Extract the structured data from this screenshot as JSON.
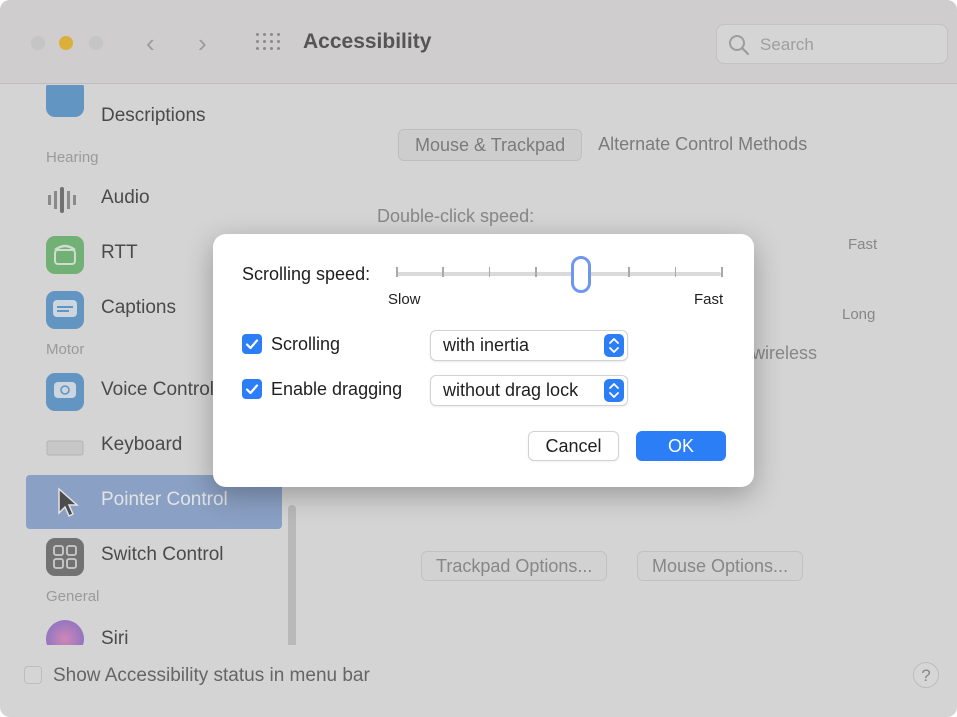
{
  "window": {
    "title": "Accessibility",
    "search_placeholder": "Search"
  },
  "sidebar": {
    "items": [
      {
        "label": "Descriptions",
        "icon": "descriptions-icon"
      },
      {
        "label": "Audio",
        "icon": "speaker-icon"
      },
      {
        "label": "RTT",
        "icon": "rtt-phone-icon"
      },
      {
        "label": "Captions",
        "icon": "captions-icon"
      },
      {
        "label": "Voice Control",
        "icon": "voice-control-icon"
      },
      {
        "label": "Keyboard",
        "icon": "keyboard-icon"
      },
      {
        "label": "Pointer Control",
        "icon": "pointer-icon",
        "selected": true
      },
      {
        "label": "Switch Control",
        "icon": "switch-control-icon"
      },
      {
        "label": "Siri",
        "icon": "siri-icon"
      }
    ],
    "headers": {
      "hearing": "Hearing",
      "motor": "Motor",
      "general": "General"
    }
  },
  "content": {
    "tabs": [
      "Mouse & Trackpad",
      "Alternate Control Methods"
    ],
    "double_click_label": "Double-click speed:",
    "fast_label": "Fast",
    "long_label": "Long",
    "wireless_partial": "wireless",
    "trackpad_options_button": "Trackpad Options...",
    "mouse_options_button": "Mouse Options..."
  },
  "bottom": {
    "status_checkbox_label": "Show Accessibility status in menu bar",
    "help_label": "?"
  },
  "dialog": {
    "scrolling_speed_label": "Scrolling speed:",
    "slider_min_label": "Slow",
    "slider_max_label": "Fast",
    "slider_value_fraction": 0.57,
    "slider_ticks": 8,
    "scrolling": {
      "label": "Scrolling",
      "checked": true,
      "popup_value": "with inertia"
    },
    "dragging": {
      "label": "Enable dragging",
      "checked": true,
      "popup_value": "without drag lock"
    },
    "cancel_label": "Cancel",
    "ok_label": "OK"
  },
  "colors": {
    "accent": "#2b7ef5",
    "selection": "#8ea9d8",
    "traffic_yellow": "#f5bd26"
  }
}
